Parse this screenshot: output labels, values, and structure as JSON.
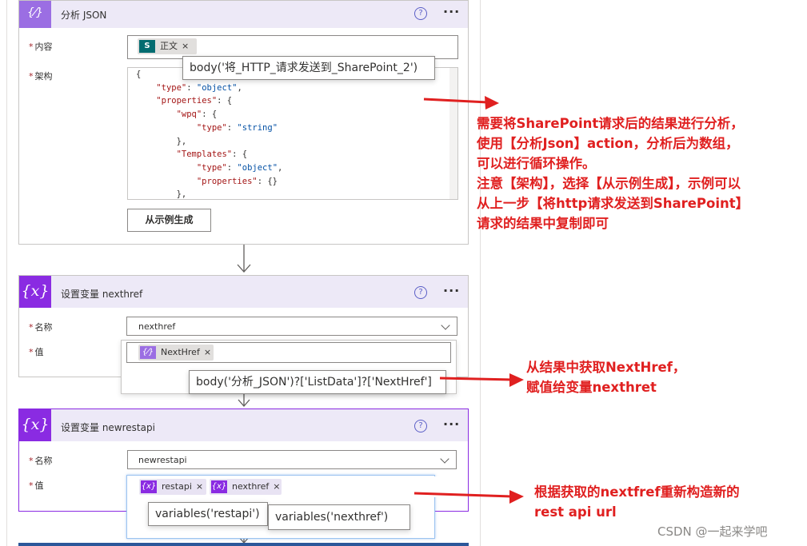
{
  "cards": {
    "parse_json": {
      "title": "分析 JSON",
      "content_label": "内容",
      "schema_label": "架构",
      "token_label": "正文",
      "token_close": "×",
      "tooltip": "body('将_HTTP_请求发送到_SharePoint_2')",
      "schema_lines": [
        [
          "{",
          ""
        ],
        [
          "    ",
          "\"type\"",
          ": ",
          "\"object\"",
          ","
        ],
        [
          "    ",
          "\"properties\"",
          ": {"
        ],
        [
          "        ",
          "\"wpq\"",
          ": {"
        ],
        [
          "            ",
          "\"type\"",
          ": ",
          "\"string\""
        ],
        [
          "        },"
        ],
        [
          "        ",
          "\"Templates\"",
          ": {"
        ],
        [
          "            ",
          "\"type\"",
          ": ",
          "\"object\"",
          ","
        ],
        [
          "            ",
          "\"properties\"",
          ": {}"
        ],
        [
          "        },"
        ]
      ],
      "generate_button": "从示例生成"
    },
    "set_nexthref": {
      "title": "设置变量 nexthref",
      "name_label": "名称",
      "name_value": "nexthref",
      "value_label": "值",
      "token_label": "NextHref",
      "token_close": "×",
      "tooltip": "body('分析_JSON')?['ListData']?['NextHref']"
    },
    "set_newrestapi": {
      "title": "设置变量 newrestapi",
      "name_label": "名称",
      "name_value": "newrestapi",
      "value_label": "值",
      "token1_label": "restapi",
      "token2_label": "nexthref",
      "token_close": "×",
      "tooltip1": "variables('restapi')",
      "tooltip2": "variables('nexthref')"
    }
  },
  "icons": {
    "variable": "{x}",
    "json": "{⁄}",
    "help": "?",
    "more": "···",
    "sharepoint": "S"
  },
  "annotations": {
    "a1": [
      "需要将SharePoint请求后的结果进行分析，",
      "使用【分析Json】action，分析后为数组，",
      "可以进行循环操作。",
      "注意【架构】，选择【从示例生成】，示例可以",
      "从上一步【将http请求发送到SharePoint】",
      "请求的结果中复制即可"
    ],
    "a2": [
      "从结果中获取NextHref，",
      "赋值给变量nexthret"
    ],
    "a3": [
      "根据获取的nextfref重新构造新的",
      "rest api url"
    ]
  },
  "watermark": "CSDN @一起来学吧",
  "colors": {
    "variable_purple": "#8a2be2",
    "header_lavender": "#ede9f7",
    "annotation_red": "#e02020",
    "help_blue": "#5b5fc7"
  }
}
